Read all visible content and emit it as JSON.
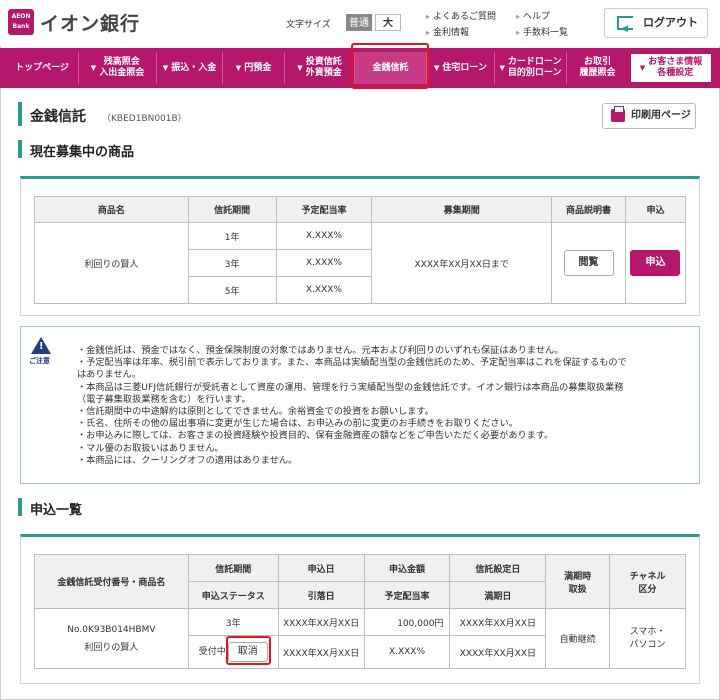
{
  "header": {
    "logo_small": "AEON Bank",
    "logo_text": "イオン銀行",
    "font_size_label": "文字サイズ",
    "font_normal": "普通",
    "font_large": "大",
    "links": [
      "よくあるご質問",
      "ヘルプ",
      "金利情報",
      "手数料一覧"
    ],
    "logout": "ログアウト"
  },
  "nav": {
    "items": [
      {
        "label": "トップページ"
      },
      {
        "label": "残高照会\n入出金照会"
      },
      {
        "label": "振込・入金"
      },
      {
        "label": "円預金"
      },
      {
        "label": "投資信託\n外貨預金"
      },
      {
        "label": "金銭信託"
      },
      {
        "label": "住宅ローン"
      },
      {
        "label": "カードローン\n目的別ローン"
      },
      {
        "label": "お取引\n履歴照会"
      },
      {
        "label": "お客さま情報\n各種設定"
      }
    ]
  },
  "page": {
    "title": "金銭信託",
    "code": "（KBED1BN001B）",
    "print_button": "印刷用ページ"
  },
  "products": {
    "section_title": "現在募集中の商品",
    "headers": [
      "商品名",
      "信託期間",
      "予定配当率",
      "募集期間",
      "商品説明書",
      "申込"
    ],
    "name": "利回りの賢人",
    "rows": [
      {
        "period": "1年",
        "rate": "X.XXX%"
      },
      {
        "period": "3年",
        "rate": "X.XXX%"
      },
      {
        "period": "5年",
        "rate": "X.XXX%"
      }
    ],
    "recruit_period": "XXXX年XX月XX日まで",
    "view_button": "閲覧",
    "apply_button": "申込"
  },
  "notice": {
    "label": "ご注意",
    "lines": [
      "・金銭信託は、預金ではなく、預金保険制度の対象ではありません。元本および利回りのいずれも保証はありません。",
      "・予定配当率は年率、税引前で表示しております。また、本商品は実績配当型の金銭信託のため、予定配当率はこれを保証するもので",
      "はありません。",
      "・本商品は三菱UFJ信託銀行が受託者として資産の運用、管理を行う実績配当型の金銭信託です。イオン銀行は本商品の募集取扱業務",
      "（電子募集取扱業務を含む）を行います。",
      "・信託期間中の中途解約は原則としてできません。余裕資金での投資をお願いします。",
      "・氏名、住所その他の届出事項に変更が生じた場合は、お申込みの前に変更のお手続きをお取りください。",
      "・お申込みに際しては、お客さまの投資経験や投資目的、保有金融資産の額などをご申告いただく必要があります。",
      "・マル優のお取扱いはありません。",
      "・本商品には、クーリングオフの適用はありません。"
    ]
  },
  "applications": {
    "section_title": "申込一覧",
    "headers": {
      "id_name": "金銭信託受付番号・商品名",
      "period": "信託期間",
      "status_h": "申込ステータス",
      "apply_date": "申込日",
      "withdraw_date": "引落日",
      "amount": "申込金額",
      "rate": "予定配当率",
      "setup_date": "信託設定日",
      "maturity_date": "満期日",
      "maturity_handling": "満期時\n取扱",
      "channel": "チャネル\n区分"
    },
    "row": {
      "id": "No.0K93B014HBMV",
      "name": "利回りの賢人",
      "period": "3年",
      "status": "受付中",
      "cancel": "取消",
      "apply_date": "XXXX年XX月XX日",
      "withdraw_date": "XXXX年XX月XX日",
      "amount": "100,000円",
      "rate": "X.XXX%",
      "setup_date": "XXXX年XX月XX日",
      "maturity_date": "XXXX年XX月XX日",
      "maturity_handling": "自動継続",
      "channel": "スマホ・\nパソコン"
    }
  },
  "colors": {
    "brand": "#b5176b",
    "accent": "#2a9a8a",
    "alert": "#e8141b"
  }
}
